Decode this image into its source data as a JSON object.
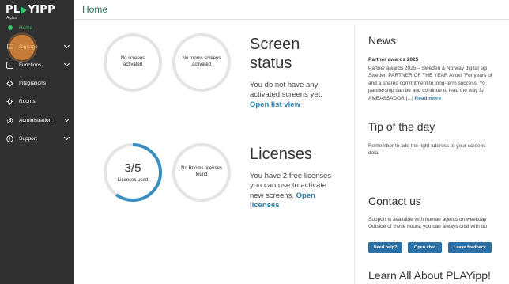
{
  "sidebar": {
    "logo_left": "PL",
    "logo_right": "YIPP",
    "logo_sub": "Alpha",
    "items": [
      {
        "label": "Home",
        "icon": "home-icon"
      },
      {
        "label": "Signage",
        "icon": "signage-icon"
      },
      {
        "label": "Functions",
        "icon": "functions-icon"
      },
      {
        "label": "Integrations",
        "icon": "integrations-icon"
      },
      {
        "label": "Rooms",
        "icon": "rooms-icon"
      },
      {
        "label": "Administration",
        "icon": "gear-icon"
      },
      {
        "label": "Support",
        "icon": "help-icon"
      }
    ],
    "colors": {
      "background": "#2f3032",
      "active": "#39c36a",
      "highlight": "#e08a3a"
    }
  },
  "header": {
    "title": "Home"
  },
  "screen_status": {
    "circle1": "No screens activated",
    "circle2": "No rooms screens activated",
    "title_line1": "Screen",
    "title_line2": "status",
    "text": "You do not have any activated screens yet.",
    "link": "Open list view"
  },
  "licenses": {
    "used_value": "3/5",
    "used_fraction": 0.6,
    "used_label": "Licenses used",
    "rooms_label": "No Rooms licenses found",
    "title": "Licenses",
    "text": "You have 2 free licenses you can use to activate new screens.",
    "link": "Open licenses"
  },
  "news": {
    "title": "News",
    "item_title": "Partner awards 2025",
    "lines": [
      "Partner awards 2025 – Sweden & Norway digital sig",
      "Sweden PARTNER OF THE YEAR Avoki \"For years of",
      "and a shared commitment to long-term success. Yo",
      "partnership can be and continue to lead the way fo",
      "AMBASSADOR [...]"
    ],
    "read_more": "Read more"
  },
  "tip": {
    "title": "Tip of the day",
    "lines": [
      "Remember to add the right address to your screens",
      "data."
    ]
  },
  "contact": {
    "title": "Contact us",
    "lines": [
      "Support is available with human agents on weekday",
      "Outside of these hours, you can always chat with ou"
    ],
    "buttons": [
      "Need help?",
      "Open chat",
      "Leave feedback"
    ]
  },
  "learn": {
    "title": "Learn All About PLAYipp!"
  }
}
